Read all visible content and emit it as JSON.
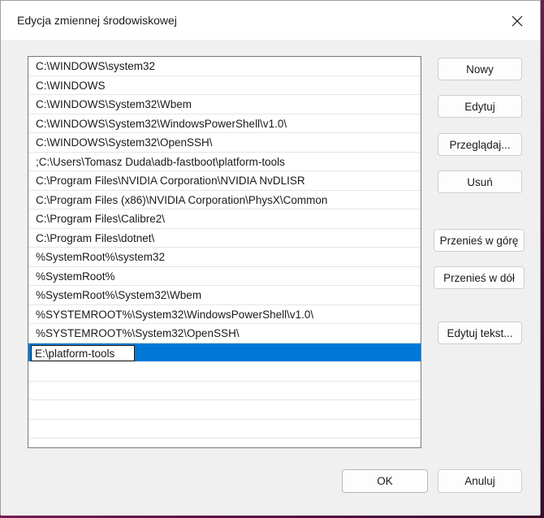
{
  "window": {
    "title": "Edycja zmiennej środowiskowej"
  },
  "paths": [
    "C:\\WINDOWS\\system32",
    "C:\\WINDOWS",
    "C:\\WINDOWS\\System32\\Wbem",
    "C:\\WINDOWS\\System32\\WindowsPowerShell\\v1.0\\",
    "C:\\WINDOWS\\System32\\OpenSSH\\",
    ";C:\\Users\\Tomasz Duda\\adb-fastboot\\platform-tools",
    "C:\\Program Files\\NVIDIA Corporation\\NVIDIA NvDLISR",
    "C:\\Program Files (x86)\\NVIDIA Corporation\\PhysX\\Common",
    "C:\\Program Files\\Calibre2\\",
    "C:\\Program Files\\dotnet\\",
    "%SystemRoot%\\system32",
    "%SystemRoot%",
    "%SystemRoot%\\System32\\Wbem",
    "%SYSTEMROOT%\\System32\\WindowsPowerShell\\v1.0\\",
    "%SYSTEMROOT%\\System32\\OpenSSH\\"
  ],
  "editing": {
    "value": "E:\\platform-tools"
  },
  "buttons": {
    "new": "Nowy",
    "edit": "Edytuj",
    "browse": "Przeglądaj...",
    "delete": "Usuń",
    "move_up": "Przenieś w górę",
    "move_down": "Przenieś w dół",
    "edit_text": "Edytuj tekst...",
    "ok": "OK",
    "cancel": "Anuluj"
  },
  "colors": {
    "selection": "#0078d7"
  }
}
